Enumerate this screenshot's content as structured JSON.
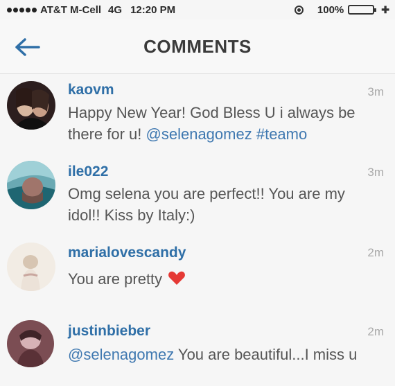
{
  "status_bar": {
    "carrier": "AT&T M-Cell",
    "network": "4G",
    "time": "12:20 PM",
    "battery": "100%",
    "icons": [
      "signal-dots-icon",
      "location-icon",
      "battery-icon",
      "charging-icon"
    ],
    "battery_color": "#2ec94a"
  },
  "nav": {
    "back_icon": "back-arrow-icon",
    "title": "COMMENTS",
    "accent_color": "#2f6fa7"
  },
  "comments": [
    {
      "username": "kaovm",
      "time": "3m",
      "text": "Happy New Year! God Bless U i always be there for u!",
      "mention": "@selenagomez",
      "hashtag": "#teamo"
    },
    {
      "username": "ile022",
      "time": "3m",
      "text": "Omg selena you are perfect!! You are my idol!! Kiss by Italy:)"
    },
    {
      "username": "marialovescandy",
      "time": "2m",
      "text": "You are pretty",
      "emoji": "heart-icon"
    },
    {
      "username": "justinbieber",
      "time": "2m",
      "mention": "@selenagomez",
      "text": "You are beautiful...I miss u"
    }
  ]
}
